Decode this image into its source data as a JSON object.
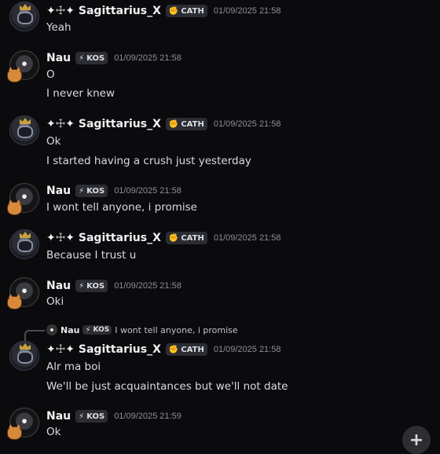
{
  "users": {
    "sagittarius": {
      "name": "✦☩✦ Sagittarius_X",
      "tag": "CATH",
      "tag_icon": "✊",
      "avatar": "crowned-knight-avatar"
    },
    "nau": {
      "name": "Nau",
      "tag": "KOS",
      "tag_icon": "⚡",
      "avatar": "anime-avatar-with-pet"
    }
  },
  "messages": [
    {
      "author": "sagittarius",
      "timestamp": "01/09/2025 21:58",
      "lines": [
        "Yeah"
      ]
    },
    {
      "author": "nau",
      "timestamp": "01/09/2025 21:58",
      "lines": [
        "O",
        "I never knew"
      ]
    },
    {
      "author": "sagittarius",
      "timestamp": "01/09/2025 21:58",
      "lines": [
        "Ok",
        "I started having a crush just yesterday"
      ]
    },
    {
      "author": "nau",
      "timestamp": "01/09/2025 21:58",
      "lines": [
        "I wont tell anyone, i promise"
      ]
    },
    {
      "author": "sagittarius",
      "timestamp": "01/09/2025 21:58",
      "lines": [
        "Because I trust u"
      ]
    },
    {
      "author": "nau",
      "timestamp": "01/09/2025 21:58",
      "lines": [
        "Oki"
      ]
    },
    {
      "author": "sagittarius",
      "timestamp": "01/09/2025 21:58",
      "lines": [
        "Alr ma boi",
        "We'll be just acquaintances but we'll not date"
      ]
    },
    {
      "author": "nau",
      "timestamp": "01/09/2025 21:59",
      "lines": [
        "Ok"
      ]
    }
  ],
  "reply_preview": {
    "name": "Nau",
    "tag": "KOS",
    "tag_icon": "⚡",
    "text": "I wont tell anyone, i promise"
  },
  "fab": {
    "label": "+"
  }
}
